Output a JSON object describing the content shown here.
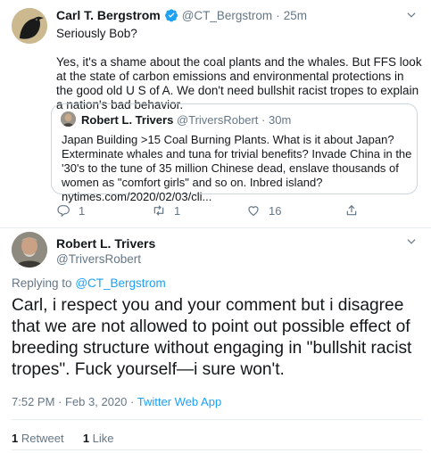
{
  "top_tweet": {
    "author_name": "Carl T. Bergstrom",
    "author_handle": "@CT_Bergstrom",
    "separator": "·",
    "time": "25m",
    "line1": "Seriously Bob?",
    "line2": "Yes, it's a shame about the coal plants and the whales. But FFS look at the state of carbon emissions and environmental protections in the good old U S of A. We don't need bullshit racist tropes to explain a nation's bad behavior.",
    "quoted": {
      "author_name": "Robert L. Trivers",
      "author_handle": "@TriversRobert",
      "separator": "·",
      "time": "30m",
      "text": "Japan Building >15 Coal Burning Plants. What is it about Japan? Exterminate whales and tuna for trivial benefits? Invade China in the '30's to the tune of 35 million Chinese dead, enslave thousands of women as \"comfort girls\" and so on. Inbred island? nytimes.com/2020/02/03/cli..."
    },
    "actions": {
      "reply_count": "1",
      "retweet_count": "1",
      "like_count": "16"
    }
  },
  "main_tweet": {
    "author_name": "Robert L. Trivers",
    "author_handle": "@TriversRobert",
    "replying_prefix": "Replying to",
    "replying_to": "@CT_Bergstrom",
    "text": "Carl, i respect you and your comment but i disagree that we are not allowed to point out possible effect of breeding structure without engaging in \"bullshit racist tropes\". Fuck yourself—i sure won't.",
    "time": "7:52 PM",
    "dot": "·",
    "date": "Feb 3, 2020",
    "dot2": "·",
    "source": "Twitter Web App",
    "retweets_count": "1",
    "retweets_label": "Retweet",
    "likes_count": "1",
    "likes_label": "Like"
  },
  "colors": {
    "accent": "#1da1f2",
    "muted": "#657786",
    "border": "#e6ecf0"
  },
  "icons": [
    "crow-avatar",
    "verified-badge-icon",
    "chevron-down-icon",
    "reply-icon",
    "retweet-icon",
    "like-icon",
    "share-icon"
  ]
}
